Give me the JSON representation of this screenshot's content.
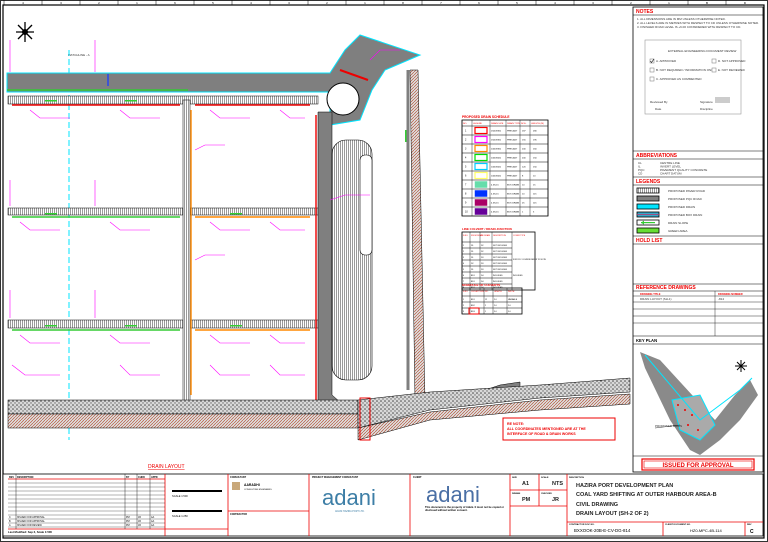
{
  "ruler": {
    "top": [
      "4",
      "3",
      "2",
      "1",
      "6",
      "5",
      "4",
      "3",
      "2",
      "1",
      "8",
      "7",
      "6",
      "5",
      "4",
      "3",
      "2",
      "1",
      "B",
      "D"
    ],
    "side": [
      "A",
      "B",
      "C",
      "D",
      "E",
      "F",
      "G"
    ]
  },
  "drawing": {
    "matchline": "MATCHLINE - A",
    "title": "DRAIN LAYOUT",
    "note_box": [
      "RE NOTE:",
      "ALL COORDINATES MENTIONED ARE AT THE",
      "INTERFACE OF ROAD & DRAIN WORKS"
    ]
  },
  "drain_schedule": {
    "title": "PROPOSED DRAIN SCHEDULE",
    "headers": [
      "NO.",
      "LEGEND",
      "DRAIN SIZE",
      "DRAIN TYPE",
      "NOS.",
      "LENGTH (M)"
    ],
    "rows": [
      {
        "no": "1",
        "color": "#ff0000",
        "size": "1500X900",
        "type": "PRECAST",
        "nos": "187",
        "len": "280"
      },
      {
        "no": "2",
        "color": "#ff00ff",
        "size": "1500X900",
        "type": "PRECAST",
        "nos": "155",
        "len": "195"
      },
      {
        "no": "3",
        "color": "#ff8800",
        "size": "1000X900",
        "type": "PRECAST",
        "nos": "200",
        "len": "160"
      },
      {
        "no": "4",
        "color": "#00dd00",
        "size": "1000X600",
        "type": "PRECAST",
        "nos": "200",
        "len": "150"
      },
      {
        "no": "5",
        "color": "#00ccff",
        "size": "1000X600",
        "type": "PRECAST",
        "nos": "120",
        "len": "150"
      },
      {
        "no": "6",
        "color": "#ffff66",
        "size": "1000X600",
        "type": "PRECAST",
        "nos": "8",
        "len": "10"
      },
      {
        "no": "7",
        "color": "#66ddaa",
        "size": "4.5X4.5",
        "type": "BOX DRAIN",
        "nos": "10",
        "len": "15"
      },
      {
        "no": "8",
        "color": "#0033ff",
        "size": "4.5X4.5",
        "type": "BOX DRAIN",
        "nos": "10",
        "len": "115"
      },
      {
        "no": "9",
        "color": "#aa0066",
        "size": "4.5X4.5",
        "type": "BOX DRAIN",
        "nos": "25",
        "len": "115"
      },
      {
        "no": "10",
        "color": "#660099",
        "size": "4.5X4.5",
        "type": "BOX DRAIN",
        "nos": "1",
        "len": "5"
      }
    ]
  },
  "crossing_schedule": {
    "title": "LINE CULVERT / DRAIN JUNCTION",
    "headers": [
      "S.NO.",
      "FROM DRAIN",
      "TO DRAIN",
      "DESCRIPTION",
      "COVER TYPE"
    ],
    "rows": [
      [
        "1",
        "D1",
        "D2",
        "NOT INCLUDED"
      ],
      [
        "2",
        "D1",
        "D2",
        "NOT INCLUDED"
      ],
      [
        "3",
        "D1",
        "D3",
        "NOT INCLUDED"
      ],
      [
        "4",
        "D2",
        "D3",
        "NOT INCLUDED"
      ],
      [
        "5",
        "D1",
        "D3",
        "NOT INCLUDED"
      ],
      [
        "6",
        "BD1",
        "D4",
        "INCLUDED"
      ],
      [
        "7",
        "BD1",
        "D4",
        "INCLUDED"
      ],
      [
        "8",
        "BD1",
        "D4",
        "INCLUDED"
      ]
    ],
    "cover_notes": [
      "FOR RCC COVERS REFER TO NOTE",
      "INCLUDED"
    ]
  },
  "culvert_schedule": {
    "title": "SCHEDULE OF CULVERTS",
    "headers": [
      "S.NO.",
      "CULVERT SIZE",
      "NO.",
      "LENGTH",
      "WIDTH"
    ],
    "rows": [
      [
        "1",
        "BD1",
        "12",
        "2.0",
        "VARIABLE"
      ],
      [
        "2",
        "BD2",
        "2",
        "2.0",
        "2.0"
      ],
      [
        "3",
        "BD3",
        "1",
        "5.0",
        "5.0"
      ]
    ]
  },
  "right_panel": {
    "notes_title": "NOTES",
    "notes": [
      "1. ALL DIMENSIONS ARE IN MM UNLESS OTHERWISE NOTED.",
      "2. ALL LEVELS ARE IN METRES WITH RESPECT TO CD UNLESS OTHERWISE NOTED.",
      "3. FINISHED ROAD LEVEL IS +6.00 CONSIDERED WITH RESPECT TO CD."
    ],
    "approval_box": {
      "title": "EXTERNAL ENGINEERING DOCUMENT REVIEW",
      "options": [
        "A. APPROVED",
        "B. NOT REQUIRED / INFORMATION ONLY",
        "C. APPROVED AS COMMENTED",
        "D. NOT APPROVED",
        "E. NOT REVIEWED"
      ],
      "checked_index": 0,
      "fields": [
        "Reviewed By",
        "Signature",
        "Date",
        "Discipline"
      ]
    },
    "abbreviations_title": "ABBREVIATIONS",
    "abbreviations": [
      {
        "code": "CL",
        "desc": "CENTRE LINE"
      },
      {
        "code": "IL",
        "desc": "INVERT LEVEL"
      },
      {
        "code": "PQC",
        "desc": "PAVEMENT QUALITY CONCRETE"
      },
      {
        "code": "CD",
        "desc": "CHART DATUM"
      }
    ],
    "legends_title": "LEGENDS",
    "legends": [
      {
        "label": "PROPOSED PAVER ROAD",
        "swatch": "hatch"
      },
      {
        "label": "PROPOSED PQC ROAD",
        "swatch": "#808080"
      },
      {
        "label": "PROPOSED DRAIN",
        "swatch": "#00e5ff"
      },
      {
        "label": "PROPOSED BOX DRAIN",
        "swatch": "#3aa6c8"
      },
      {
        "label": "DRAIN SLOPE",
        "swatch": "arrow"
      },
      {
        "label": "GREEN AREA",
        "swatch": "#66dd33"
      }
    ],
    "hold_list_title": "HOLD LIST",
    "reference_title": "REFERENCE DRAWINGS",
    "reference_headers": [
      "DRAWING TITLE",
      "DRAWING NUMBER"
    ],
    "reference_rows": [
      [
        "DRAIN LAYOUT (SH-1)",
        "-814"
      ]
    ],
    "key_plan_title": "KEY PLAN",
    "key_plan_label": "PROPOSED DRAIN",
    "stamp": "ISSUED FOR APPROVAL"
  },
  "title_block": {
    "revision_headers": [
      "REV",
      "DESCRIPTION",
      "BY",
      "CHKD",
      "APPD"
    ],
    "revisions": [
      [
        "C",
        "ISSUED FOR APPROVAL",
        "PM",
        "JR",
        "AA"
      ],
      [
        "B",
        "ISSUED FOR APPROVAL",
        "PM",
        "JR",
        "AA"
      ],
      [
        "A",
        "ISSUED FOR REVIEW",
        "PM",
        "JR",
        "AA"
      ]
    ],
    "file_note": "Last Modified: Sep 2, Scale 1:500",
    "scale_bars": [
      "SCALE 1:500",
      "SCALE 1:250"
    ],
    "consultant": "AARADHI",
    "consultant_sub": "CONSULTING ENGINEERS",
    "consultant_label": "CONSULTANT",
    "contractor_label": "CONTRACTOR",
    "pmc_label": "PROJECT MANAGEMENT CONSULTANT",
    "pmc_logo": "adani",
    "pmc_sub": "ADANI HAZIRA PORT LTD.",
    "client_label": "CLIENT",
    "client_logo": "adani",
    "client_note": "This document is the property of Adani. It must not be copied or disclosed without written consent.",
    "size_label": "SIZE",
    "size": "A1",
    "scale_label": "SCALE",
    "scale": "NTS",
    "drawn_label": "DRAWN",
    "drawn": "PM",
    "checked_label": "CHECKED",
    "checked": "JR",
    "description_label": "DESCRIPTION",
    "lines": [
      "HAZIRA PORT DEVELOPMENT PLAN",
      "COAL YARD SHIFTING AT OUTER HARBOUR AREA-B",
      "CIVIL DRAWING",
      "DRAIN LAYOUT (SH-2 OF 2)"
    ],
    "doc_no_label": "CONTRACTOR DOC NO.",
    "doc_no": "BXXOOK-20B-E-CV-DG-814",
    "client_doc_label": "CLIENT DOCUMENT NO.",
    "client_doc": "HZ0-MPC-4B-114",
    "rev_label": "REV",
    "rev": "C"
  },
  "colors": {
    "red": "#ee0000",
    "cyan": "#00e5ff",
    "magenta": "#ff00ff",
    "road": "#7f7f7f",
    "blue": "#1a3cff",
    "green": "#33cc33"
  }
}
